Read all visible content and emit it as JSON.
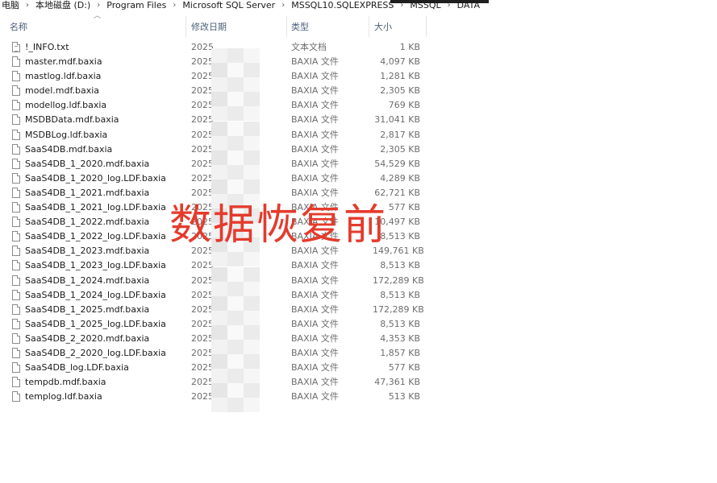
{
  "breadcrumb": [
    "电脑",
    "本地磁盘 (D:)",
    "Program Files",
    "Microsoft SQL Server",
    "MSSQL10.SQLEXPRESS",
    "MSSQL",
    "DATA"
  ],
  "columns": {
    "name": "名称",
    "date": "修改日期",
    "type": "类型",
    "size": "大小"
  },
  "files": [
    {
      "name": "!_INFO.txt",
      "date": "2025",
      "type": "文本文档",
      "size": "1 KB",
      "icon": "text-file-icon"
    },
    {
      "name": "master.mdf.baxia",
      "date": "2025",
      "type": "BAXIA 文件",
      "size": "4,097 KB",
      "icon": "file-icon"
    },
    {
      "name": "mastlog.ldf.baxia",
      "date": "2025",
      "type": "BAXIA 文件",
      "size": "1,281 KB",
      "icon": "file-icon"
    },
    {
      "name": "model.mdf.baxia",
      "date": "2025",
      "type": "BAXIA 文件",
      "size": "2,305 KB",
      "icon": "file-icon"
    },
    {
      "name": "modellog.ldf.baxia",
      "date": "2025",
      "type": "BAXIA 文件",
      "size": "769 KB",
      "icon": "file-icon"
    },
    {
      "name": "MSDBData.mdf.baxia",
      "date": "2025",
      "type": "BAXIA 文件",
      "size": "31,041 KB",
      "icon": "file-icon"
    },
    {
      "name": "MSDBLog.ldf.baxia",
      "date": "2025",
      "type": "BAXIA 文件",
      "size": "2,817 KB",
      "icon": "file-icon"
    },
    {
      "name": "SaaS4DB.mdf.baxia",
      "date": "2025",
      "type": "BAXIA 文件",
      "size": "2,305 KB",
      "icon": "file-icon"
    },
    {
      "name": "SaaS4DB_1_2020.mdf.baxia",
      "date": "2025",
      "type": "BAXIA 文件",
      "size": "54,529 KB",
      "icon": "file-icon"
    },
    {
      "name": "SaaS4DB_1_2020_log.LDF.baxia",
      "date": "2025",
      "type": "BAXIA 文件",
      "size": "4,289 KB",
      "icon": "file-icon"
    },
    {
      "name": "SaaS4DB_1_2021.mdf.baxia",
      "date": "2025",
      "type": "BAXIA 文件",
      "size": "62,721 KB",
      "icon": "file-icon"
    },
    {
      "name": "SaaS4DB_1_2021_log.LDF.baxia",
      "date": "2025",
      "type": "BAXIA 文件",
      "size": "577 KB",
      "icon": "file-icon"
    },
    {
      "name": "SaaS4DB_1_2022.mdf.baxia",
      "date": "2025",
      "type": "BAXIA 文件",
      "size": "10,497 KB",
      "icon": "file-icon"
    },
    {
      "name": "SaaS4DB_1_2022_log.LDF.baxia",
      "date": "2025",
      "type": "BAXIA 文件",
      "size": "8,513 KB",
      "icon": "file-icon"
    },
    {
      "name": "SaaS4DB_1_2023.mdf.baxia",
      "date": "2025",
      "type": "BAXIA 文件",
      "size": "149,761 KB",
      "icon": "file-icon"
    },
    {
      "name": "SaaS4DB_1_2023_log.LDF.baxia",
      "date": "2025",
      "type": "BAXIA 文件",
      "size": "8,513 KB",
      "icon": "file-icon"
    },
    {
      "name": "SaaS4DB_1_2024.mdf.baxia",
      "date": "2025",
      "type": "BAXIA 文件",
      "size": "172,289 KB",
      "icon": "file-icon"
    },
    {
      "name": "SaaS4DB_1_2024_log.LDF.baxia",
      "date": "2025",
      "type": "BAXIA 文件",
      "size": "8,513 KB",
      "icon": "file-icon"
    },
    {
      "name": "SaaS4DB_1_2025.mdf.baxia",
      "date": "2025",
      "type": "BAXIA 文件",
      "size": "172,289 KB",
      "icon": "file-icon"
    },
    {
      "name": "SaaS4DB_1_2025_log.LDF.baxia",
      "date": "2025",
      "type": "BAXIA 文件",
      "size": "8,513 KB",
      "icon": "file-icon"
    },
    {
      "name": "SaaS4DB_2_2020.mdf.baxia",
      "date": "2025",
      "type": "BAXIA 文件",
      "size": "4,353 KB",
      "icon": "file-icon"
    },
    {
      "name": "SaaS4DB_2_2020_log.LDF.baxia",
      "date": "2025",
      "type": "BAXIA 文件",
      "size": "1,857 KB",
      "icon": "file-icon"
    },
    {
      "name": "SaaS4DB_log.LDF.baxia",
      "date": "2025",
      "type": "BAXIA 文件",
      "size": "577 KB",
      "icon": "file-icon"
    },
    {
      "name": "tempdb.mdf.baxia",
      "date": "2025",
      "type": "BAXIA 文件",
      "size": "47,361 KB",
      "icon": "file-icon"
    },
    {
      "name": "templog.ldf.baxia",
      "date": "2025",
      "type": "BAXIA 文件",
      "size": "513 KB",
      "icon": "file-icon"
    }
  ],
  "overlay_text": "数据恢复前",
  "colors": {
    "overlay": "#e43b2c",
    "header_text": "#4c607a",
    "detail_text": "#6d6d6d"
  }
}
